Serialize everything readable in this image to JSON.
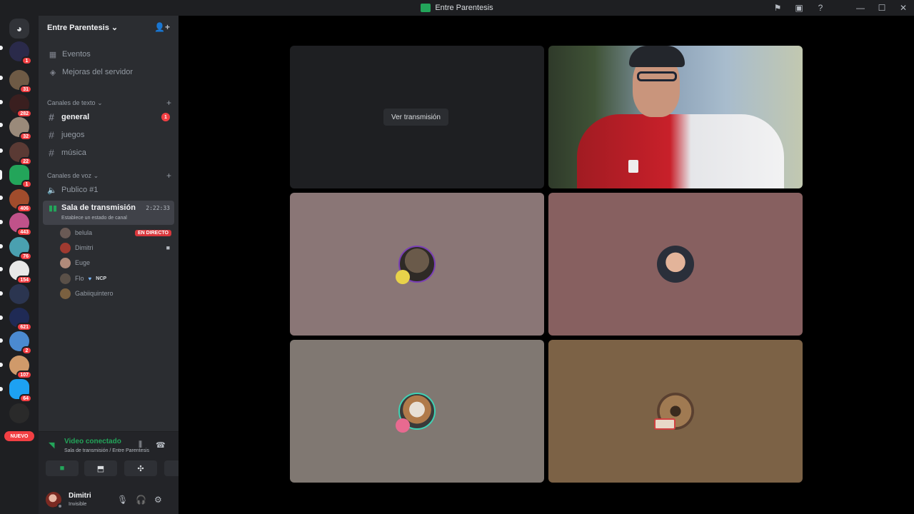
{
  "window": {
    "title": "Entre Parentesis"
  },
  "rail": {
    "badges": [
      "1",
      "31",
      "282",
      "32",
      "22",
      "1",
      "406",
      "443",
      "76",
      "154",
      "621",
      "2",
      "107",
      "64"
    ],
    "new_label": "NUEVO"
  },
  "server": {
    "name": "Entre Parentesis",
    "events_label": "Eventos",
    "boosts_label": "Mejoras del servidor",
    "text_category": "Canales de texto",
    "voice_category": "Canales de voz",
    "text_channels": [
      {
        "name": "general",
        "mentions": "1"
      },
      {
        "name": "juegos"
      },
      {
        "name": "música"
      }
    ],
    "voice_channels": [
      {
        "name": "Publico #1"
      },
      {
        "name": "Sala de transmisión",
        "status": "Establece un estado de canal",
        "timer": "2:22:33"
      }
    ],
    "voice_users": [
      {
        "name": "belula",
        "live_label": "EN DIRECTO"
      },
      {
        "name": "Dimitri"
      },
      {
        "name": "Euge"
      },
      {
        "name": "Flo",
        "tag": "NCP"
      },
      {
        "name": "Gabiiquintero"
      }
    ]
  },
  "rtc": {
    "status": "Video conectado",
    "location": "Sala de transmisión / Entre Parentesis"
  },
  "user": {
    "name": "Dimitri",
    "status": "Invisible"
  },
  "stage": {
    "watch_label": "Ver transmisión"
  },
  "colors": {
    "online_green": "#23a55a",
    "danger_red": "#f23f43",
    "tile_mauve": "#8a7676",
    "tile_rose": "#876060",
    "tile_gray": "#807872",
    "tile_brown": "#7c6246"
  }
}
